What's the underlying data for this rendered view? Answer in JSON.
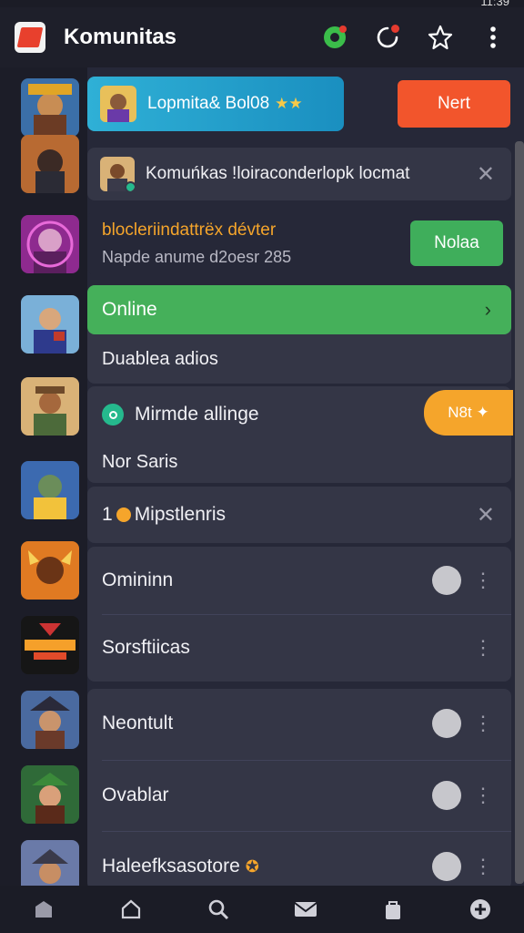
{
  "status_bar": {
    "time": "11:39"
  },
  "app_bar": {
    "title": "Komunitas",
    "icons": [
      "app-logo-icon",
      "settings-badge-icon",
      "notification-icon",
      "star-icon",
      "more-vertical-icon"
    ]
  },
  "featured": {
    "label": "Lopmita& Bol08",
    "stars": "★★",
    "next_label": "Nert"
  },
  "community_post": {
    "text": "Komuńkas !loiraconderlopk locmat",
    "close": "✕"
  },
  "tournament": {
    "title": "blocleriindattrëx dévter",
    "subtitle": "Napde anume  d2oesr 285",
    "button_label": "Nolaa"
  },
  "online": {
    "label": "Online",
    "chevron": "›"
  },
  "sections": {
    "duablea": "Duablea adios",
    "mirmade": "Mirmde allinge",
    "mirmade_chip": "N8t ✦",
    "nor_saris": "Nor Saris",
    "mipstiands_prefix": "1",
    "mipstiands": "Mipstlenris"
  },
  "settings_rows": [
    {
      "label": "Omininn",
      "toggle": true
    },
    {
      "label": "Sorsftiicas",
      "toggle": false
    },
    {
      "label": "Neontult",
      "toggle": true
    },
    {
      "label": "Ovablar",
      "toggle": true
    },
    {
      "label": "Haleefksasotore",
      "toggle": true
    }
  ],
  "theme": {
    "accent_green": "#45b05a",
    "accent_orange": "#f2552c",
    "accent_teal": "#25b98d",
    "accent_blue": "#2fb0d6",
    "background": "#262838"
  },
  "bottom_nav": [
    "home-icon",
    "house-icon",
    "search-icon",
    "mail-icon",
    "bag-icon",
    "add-icon"
  ]
}
